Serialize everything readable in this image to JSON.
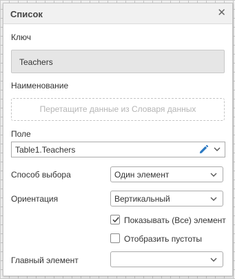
{
  "panel": {
    "title": "Список",
    "close_glyph": "✕",
    "close_icon": "close-icon"
  },
  "key": {
    "label": "Ключ",
    "value": "Teachers"
  },
  "name": {
    "label": "Наименование",
    "placeholder": "Перетащите данные из Словаря данных"
  },
  "field": {
    "label": "Поле",
    "value": "Table1.Teachers",
    "edit_icon": "pencil-icon",
    "dropdown_icon": "chevron-down-icon"
  },
  "selection_mode": {
    "label": "Способ выбора",
    "value": "Один элемент"
  },
  "orientation": {
    "label": "Ориентация",
    "value": "Вертикальный"
  },
  "show_all": {
    "label": "Показывать (Все) элемент",
    "checked": true
  },
  "show_blanks": {
    "label": "Отобразить пустоты",
    "checked": false
  },
  "main_element": {
    "label": "Главный элемент",
    "value": ""
  },
  "colors": {
    "accent": "#2b79c2",
    "header_bg": "#f1f1f1"
  }
}
